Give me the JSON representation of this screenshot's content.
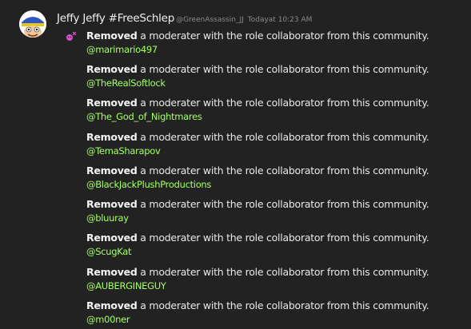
{
  "post": {
    "author": "Jeffy Jeffy #FreeSchlep",
    "handle": "@GreenAssassin_JJ",
    "timestamp": "Todayat 10:23 AM",
    "event_icon": "moderation-event-icon",
    "avatar_icon": "puppet-avatar"
  },
  "colors": {
    "background": "#222222",
    "username": "#a3ff63",
    "text": "#e8e8e8",
    "muted": "#8a8a8a"
  },
  "entries": [
    {
      "action": "Removed",
      "message": "a moderater with the role collaborator from this community.",
      "user": "@marimario497"
    },
    {
      "action": "Removed",
      "message": "a moderater with the role collaborator from this community.",
      "user": "@TheRealSoftlock"
    },
    {
      "action": "Removed",
      "message": "a moderater with the role collaborator from this community.",
      "user": "@The_God_of_Nightmares"
    },
    {
      "action": "Removed",
      "message": "a moderater with the role collaborator from this community.",
      "user": "@TemaSharapov"
    },
    {
      "action": "Removed",
      "message": "a moderater with the role collaborator from this community.",
      "user": "@BlackJackPlushProductions"
    },
    {
      "action": "Removed",
      "message": "a moderater with the role collaborator from this community.",
      "user": "@bluuray"
    },
    {
      "action": "Removed",
      "message": "a moderater with the role collaborator from this community.",
      "user": "@ScugKat"
    },
    {
      "action": "Removed",
      "message": "a moderater with the role collaborator from this community.",
      "user": "@AUBERGINEGUY"
    },
    {
      "action": "Removed",
      "message": "a moderater with the role collaborator from this community.",
      "user": "@m00ner"
    }
  ]
}
